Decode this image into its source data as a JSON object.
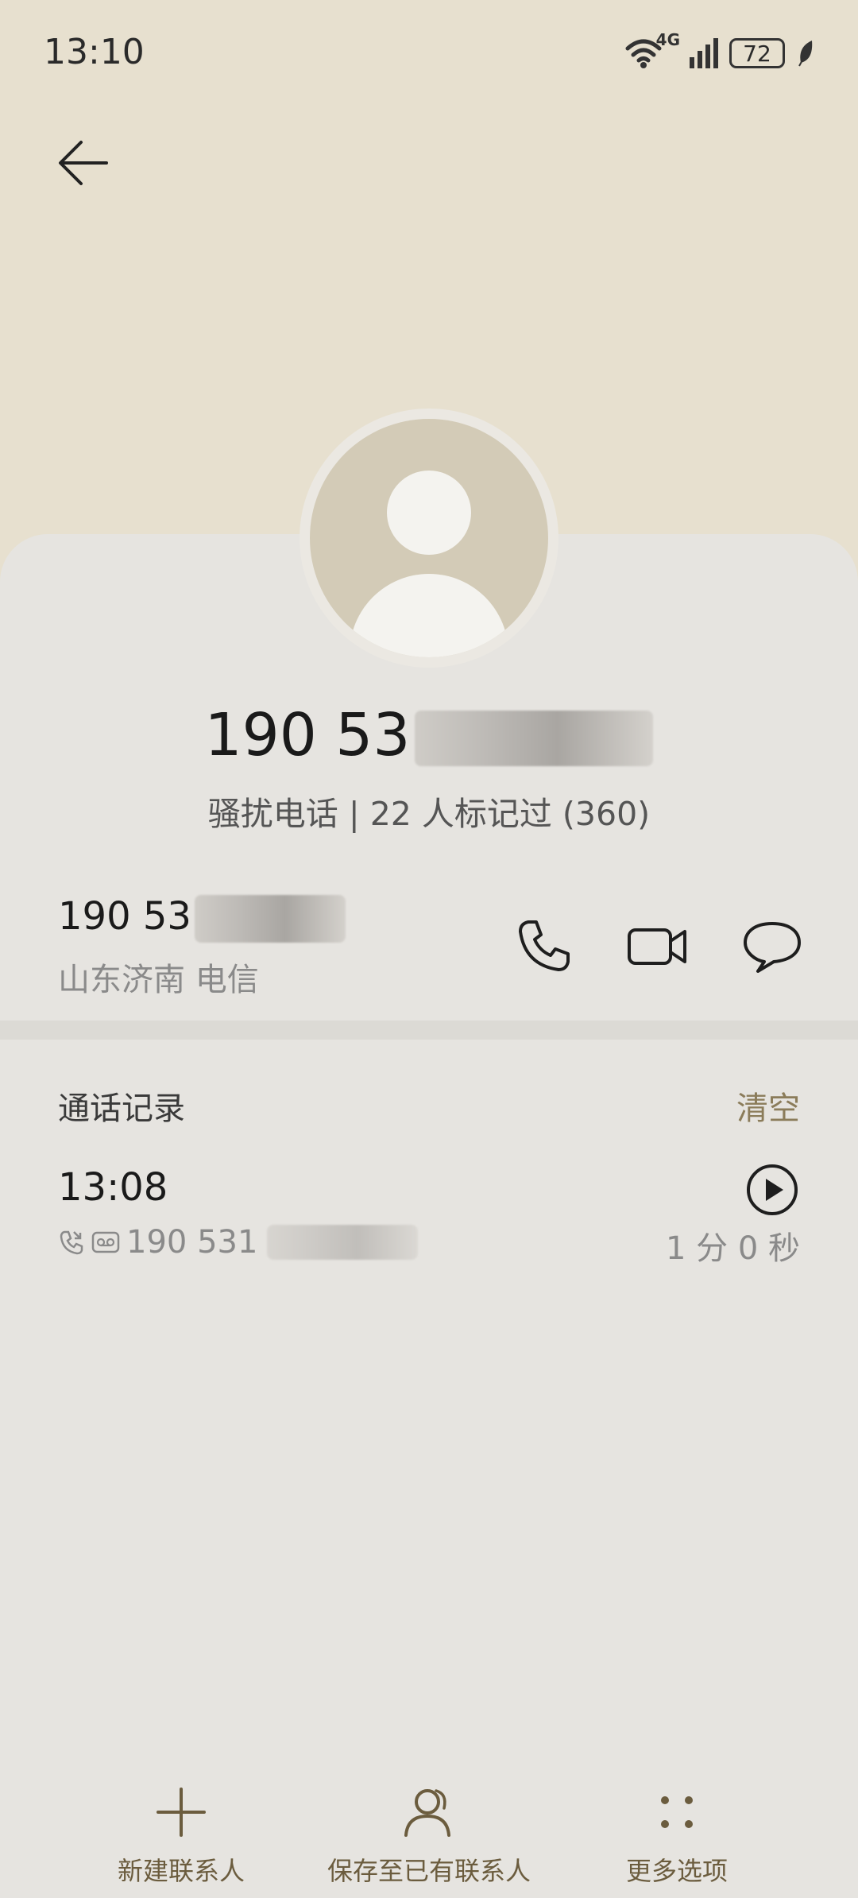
{
  "status_bar": {
    "time": "13:10",
    "network": "4G",
    "battery": "72"
  },
  "contact": {
    "number_prefix": "190 53",
    "tag": "骚扰电话 | 22 人标记过 (360)"
  },
  "number_row": {
    "number_prefix": "190 53",
    "location": "山东济南 电信"
  },
  "call_log": {
    "title": "通话记录",
    "clear_label": "清空",
    "entries": [
      {
        "time": "13:08",
        "number_prefix": "190 531",
        "duration": "1 分 0 秒"
      }
    ]
  },
  "bottom_bar": {
    "new_contact": "新建联系人",
    "save_existing": "保存至已有联系人",
    "more_options": "更多选项"
  },
  "colors": {
    "header_bg": "#e7e0cf",
    "card_bg": "#e6e4e0",
    "accent": "#8b7c5a"
  }
}
